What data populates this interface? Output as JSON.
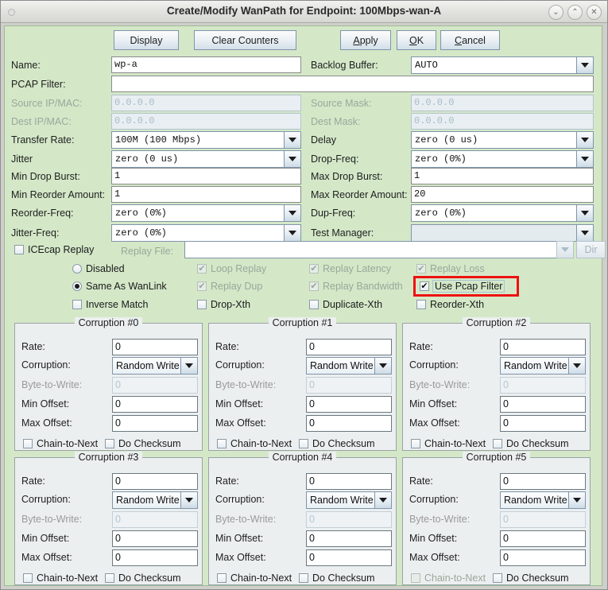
{
  "window": {
    "title": "Create/Modify WanPath for Endpoint: 100Mbps-wan-A",
    "minimize": "⌄",
    "maximize": "⌃",
    "close": "✕"
  },
  "toolbar": {
    "display": "Display",
    "clear_counters": "Clear Counters",
    "apply_pre": "",
    "apply_mn": "A",
    "apply_post": "pply",
    "ok_mn": "O",
    "ok_post": "K",
    "cancel_mn": "C",
    "cancel_post": "ancel"
  },
  "form": {
    "name_label": "Name:",
    "name_value": "wp-a",
    "backlog_label": "Backlog Buffer:",
    "backlog_value": "AUTO",
    "pcap_label": "PCAP Filter:",
    "pcap_value": "",
    "src_ip_label": "Source IP/MAC:",
    "src_ip_value": "0.0.0.0",
    "src_mask_label": "Source Mask:",
    "src_mask_value": "0.0.0.0",
    "dst_ip_label": "Dest IP/MAC:",
    "dst_ip_value": "0.0.0.0",
    "dst_mask_label": "Dest Mask:",
    "dst_mask_value": "0.0.0.0",
    "transfer_rate_label": "Transfer Rate:",
    "transfer_rate_value": "100M   (100 Mbps)",
    "delay_label": "Delay",
    "delay_value": "zero (0 us)",
    "jitter_label": "Jitter",
    "jitter_value": "zero (0 us)",
    "drop_freq_label": "Drop-Freq:",
    "drop_freq_value": "zero (0%)",
    "min_drop_burst_label": "Min Drop Burst:",
    "min_drop_burst_value": "1",
    "max_drop_burst_label": "Max Drop Burst:",
    "max_drop_burst_value": "1",
    "min_reorder_label": "Min Reorder Amount:",
    "min_reorder_value": "1",
    "max_reorder_label": "Max Reorder Amount:",
    "max_reorder_value": "20",
    "reorder_freq_label": "Reorder-Freq:",
    "reorder_freq_value": "zero (0%)",
    "dup_freq_label": "Dup-Freq:",
    "dup_freq_value": "zero (0%)",
    "jitter_freq_label": "Jitter-Freq:",
    "jitter_freq_value": "zero (0%)",
    "test_manager_label": "Test Manager:",
    "test_manager_value": "",
    "icecap_replay_label": "ICEcap Replay",
    "replay_file_label": "Replay File:",
    "replay_file_value": "",
    "dir_button": "Dir"
  },
  "options": {
    "disabled_radio": "Disabled",
    "same_as_wanlink_radio": "Same As WanLink",
    "inverse_match": "Inverse Match",
    "loop_replay": "Loop Replay",
    "replay_dup": "Replay Dup",
    "drop_xth": "Drop-Xth",
    "replay_latency": "Replay Latency",
    "replay_bandwidth": "Replay Bandwidth",
    "duplicate_xth": "Duplicate-Xth",
    "replay_loss": "Replay Loss",
    "use_pcap_filter": "Use Pcap Filter",
    "reorder_xth": "Reorder-Xth",
    "check_mark": "✔",
    "highlight_color": "#ee1111"
  },
  "corruption_labels": {
    "rate": "Rate:",
    "corruption": "Corruption:",
    "byte_to_write": "Byte-to-Write:",
    "min_offset": "Min Offset:",
    "max_offset": "Max Offset:",
    "chain_to_next": "Chain-to-Next",
    "do_checksum": "Do Checksum"
  },
  "corruptions": [
    {
      "title": "Corruption #0",
      "rate": "0",
      "corruption": "Random Write",
      "byte_to_write": "0",
      "min_offset": "0",
      "max_offset": "0",
      "chain_disabled": false
    },
    {
      "title": "Corruption #1",
      "rate": "0",
      "corruption": "Random Write",
      "byte_to_write": "0",
      "min_offset": "0",
      "max_offset": "0",
      "chain_disabled": false
    },
    {
      "title": "Corruption #2",
      "rate": "0",
      "corruption": "Random Write",
      "byte_to_write": "0",
      "min_offset": "0",
      "max_offset": "0",
      "chain_disabled": false
    },
    {
      "title": "Corruption #3",
      "rate": "0",
      "corruption": "Random Write",
      "byte_to_write": "0",
      "min_offset": "0",
      "max_offset": "0",
      "chain_disabled": false
    },
    {
      "title": "Corruption #4",
      "rate": "0",
      "corruption": "Random Write",
      "byte_to_write": "0",
      "min_offset": "0",
      "max_offset": "0",
      "chain_disabled": false
    },
    {
      "title": "Corruption #5",
      "rate": "0",
      "corruption": "Random Write",
      "byte_to_write": "0",
      "min_offset": "0",
      "max_offset": "0",
      "chain_disabled": true
    }
  ]
}
